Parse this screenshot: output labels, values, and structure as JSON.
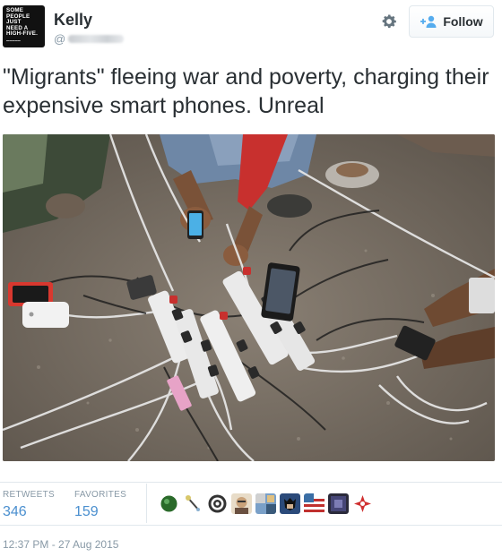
{
  "author": {
    "name": "Kelly",
    "handle_prefix": "@",
    "avatar_text": [
      "SOME",
      "PEOPLE",
      "JUST",
      "NEED A",
      "HIGH-FIVE."
    ],
    "avatar_icon": "avatar-image"
  },
  "header": {
    "settings_icon": "gear-icon",
    "follow_label": "Follow",
    "follow_icon": "add-user-icon",
    "follow_icon_color": "#55acee"
  },
  "tweet": {
    "text": "\"Migrants\" fleeing war and poverty, charging their expensive smart phones. Unreal",
    "photo_icon": "photo-people-charging-phones"
  },
  "stats": {
    "retweets_label": "RETWEETS",
    "retweets_count": "346",
    "favorites_label": "FAVORITES",
    "favorites_count": "159",
    "accent_color": "#4a8fcf"
  },
  "favorited_by": [
    {
      "icon": "green-sphere-avatar",
      "color": "#2a6a2a"
    },
    {
      "icon": "wand-avatar",
      "color": "#d9c86a"
    },
    {
      "icon": "mandala-avatar",
      "color": "#333333"
    },
    {
      "icon": "face-avatar",
      "color": "#c9a27a"
    },
    {
      "icon": "collage-avatar",
      "color": "#7aa0c8"
    },
    {
      "icon": "batman-avatar",
      "color": "#2b4a7a"
    },
    {
      "icon": "flag-avatar",
      "color": "#3a6ea5"
    },
    {
      "icon": "dark-pattern-avatar",
      "color": "#2a2a3a"
    },
    {
      "icon": "red-logo-avatar",
      "color": "#d03030"
    }
  ],
  "timestamp": "12:37 PM - 27 Aug 2015"
}
